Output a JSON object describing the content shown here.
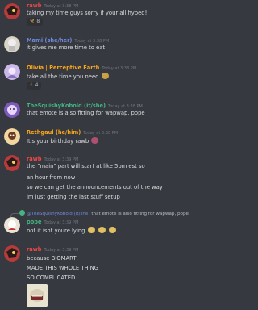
{
  "messages": [
    {
      "user": "rawb",
      "color": "#f04747",
      "ts": "Today at 3:38 PM",
      "lines": [
        "taking my time guys sorry if your all hyped!"
      ],
      "reaction": {
        "count": "8"
      }
    },
    {
      "user": "Mami (she/her)",
      "color": "#7289da",
      "ts": "Today at 3:38 PM",
      "lines": [
        "it gives me more time to eat"
      ]
    },
    {
      "user": "Olivia | Perceptive Earth",
      "color": "#faa61a",
      "ts": "Today at 3:38 PM",
      "lines": [
        "take all the time you need"
      ],
      "reaction": {
        "count": "4"
      }
    },
    {
      "user": "TheSquishyKobold (it/she)",
      "color": "#43b581",
      "ts": "Today at 3:38 PM",
      "lines": [
        "that emote is also fitting for wapwap, pope"
      ]
    },
    {
      "user": "Rethgaul (he/him)",
      "color": "#faa61a",
      "ts": "Today at 3:38 PM",
      "lines": [
        "It's your birthday rawb"
      ]
    },
    {
      "user": "rawb",
      "color": "#f04747",
      "ts": "Today at 3:39 PM",
      "lines": [
        "the \"main\" part will start at like 5pm est so",
        "an hour from now",
        "so we can get the announcements out of the way",
        "im just getting the last stuff setup"
      ]
    },
    {
      "user": "pope",
      "color": "#43b581",
      "ts": "Today at 3:39 PM",
      "reply": {
        "mention": "@TheSquishyKobold (it/she)",
        "text": " that emote is also fitting for wapwap, pope"
      },
      "lines": [
        "not it isnt youre lying"
      ]
    },
    {
      "user": "rawb",
      "color": "#f04747",
      "ts": "Today at 3:39 PM",
      "lines": [
        "because BIOMART",
        "MADE THIS WHOLE THING",
        "SO COMPLICATED"
      ]
    }
  ],
  "colors": {
    "background": "#36393f",
    "text": "#dcddde",
    "timestamp": "#72767d",
    "mention": "#7289da"
  }
}
